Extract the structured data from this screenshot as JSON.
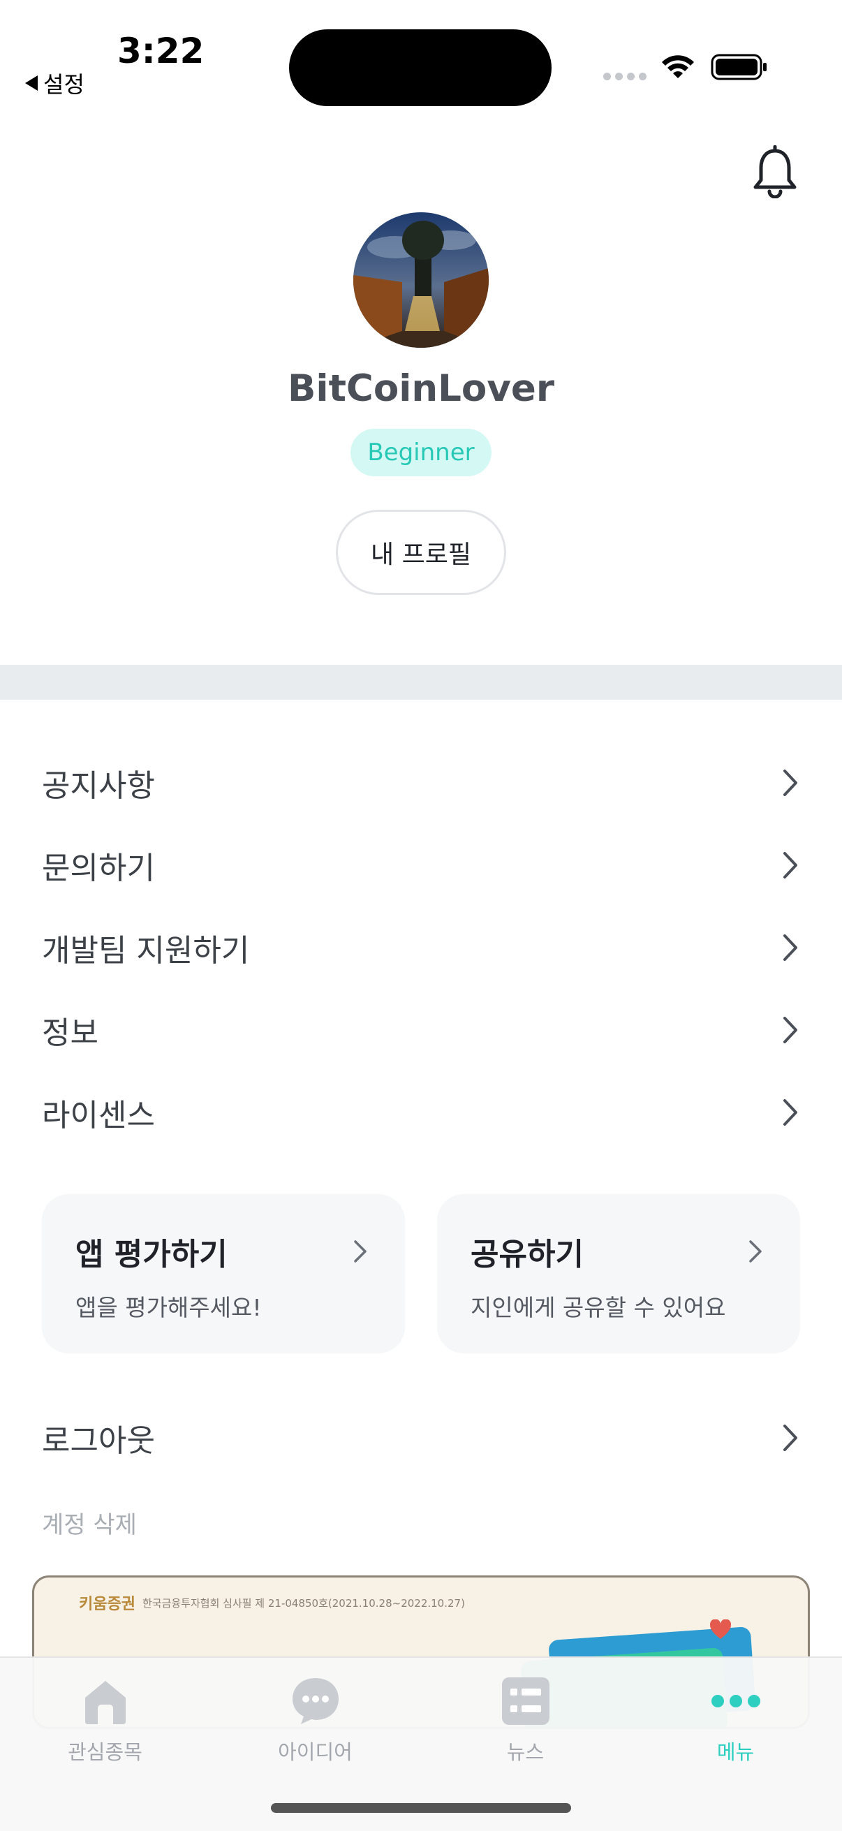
{
  "status_bar": {
    "time": "3:22",
    "back_label": "설정"
  },
  "profile": {
    "username": "BitCoinLover",
    "level_badge": "Beginner",
    "profile_button": "내 프로필"
  },
  "menu": {
    "items": [
      {
        "label": "공지사항"
      },
      {
        "label": "문의하기"
      },
      {
        "label": "개발팀 지원하기"
      },
      {
        "label": "정보"
      },
      {
        "label": "라이센스"
      }
    ]
  },
  "cards": {
    "rate": {
      "title": "앱 평가하기",
      "subtitle": "앱을 평가해주세요!"
    },
    "share": {
      "title": "공유하기",
      "subtitle": "지인에게 공유할 수 있어요"
    }
  },
  "logout_label": "로그아웃",
  "delete_account_label": "계정 삭제",
  "banner": {
    "brand": "키움증권",
    "text": "한국금융투자협회 심사필 제 21-04850호(2021.10.28~2022.10.27)"
  },
  "tabs": [
    {
      "label": "관심종목",
      "icon": "home-icon"
    },
    {
      "label": "아이디어",
      "icon": "chat-icon"
    },
    {
      "label": "뉴스",
      "icon": "news-icon"
    },
    {
      "label": "메뉴",
      "icon": "more-icon",
      "active": true
    }
  ],
  "colors": {
    "accent": "#2dcfc0",
    "badge_bg": "#d4f8f3",
    "inactive": "#a3a7ad"
  }
}
